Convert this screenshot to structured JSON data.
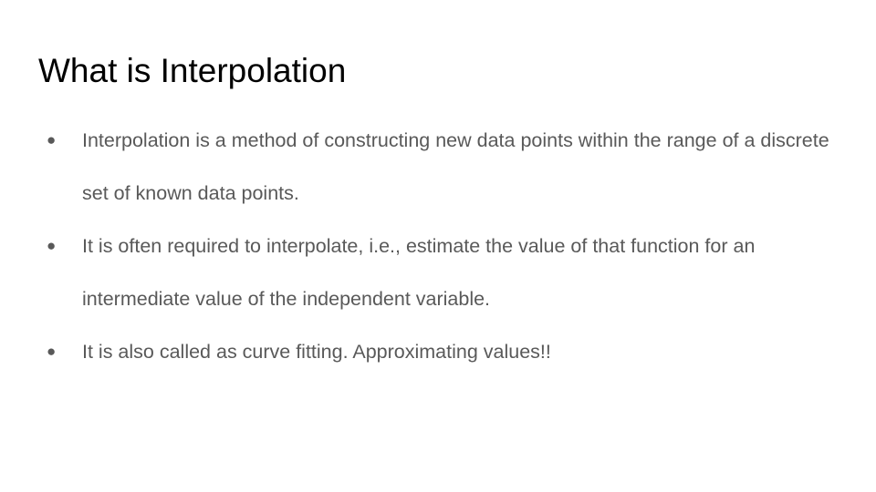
{
  "slide": {
    "title": "What is Interpolation",
    "bullet_glyph": "●",
    "bullets": [
      {
        "text": "Interpolation is a method of constructing new data points within the range of a discrete set of known data points."
      },
      {
        "text": "It is often required to interpolate, i.e., estimate the value of that function for an intermediate value of the independent variable."
      },
      {
        "text": "It is also called as curve fitting. Approximating values!!"
      }
    ]
  },
  "colors": {
    "background": "#ffffff",
    "title": "#000000",
    "body_text": "#595959"
  }
}
